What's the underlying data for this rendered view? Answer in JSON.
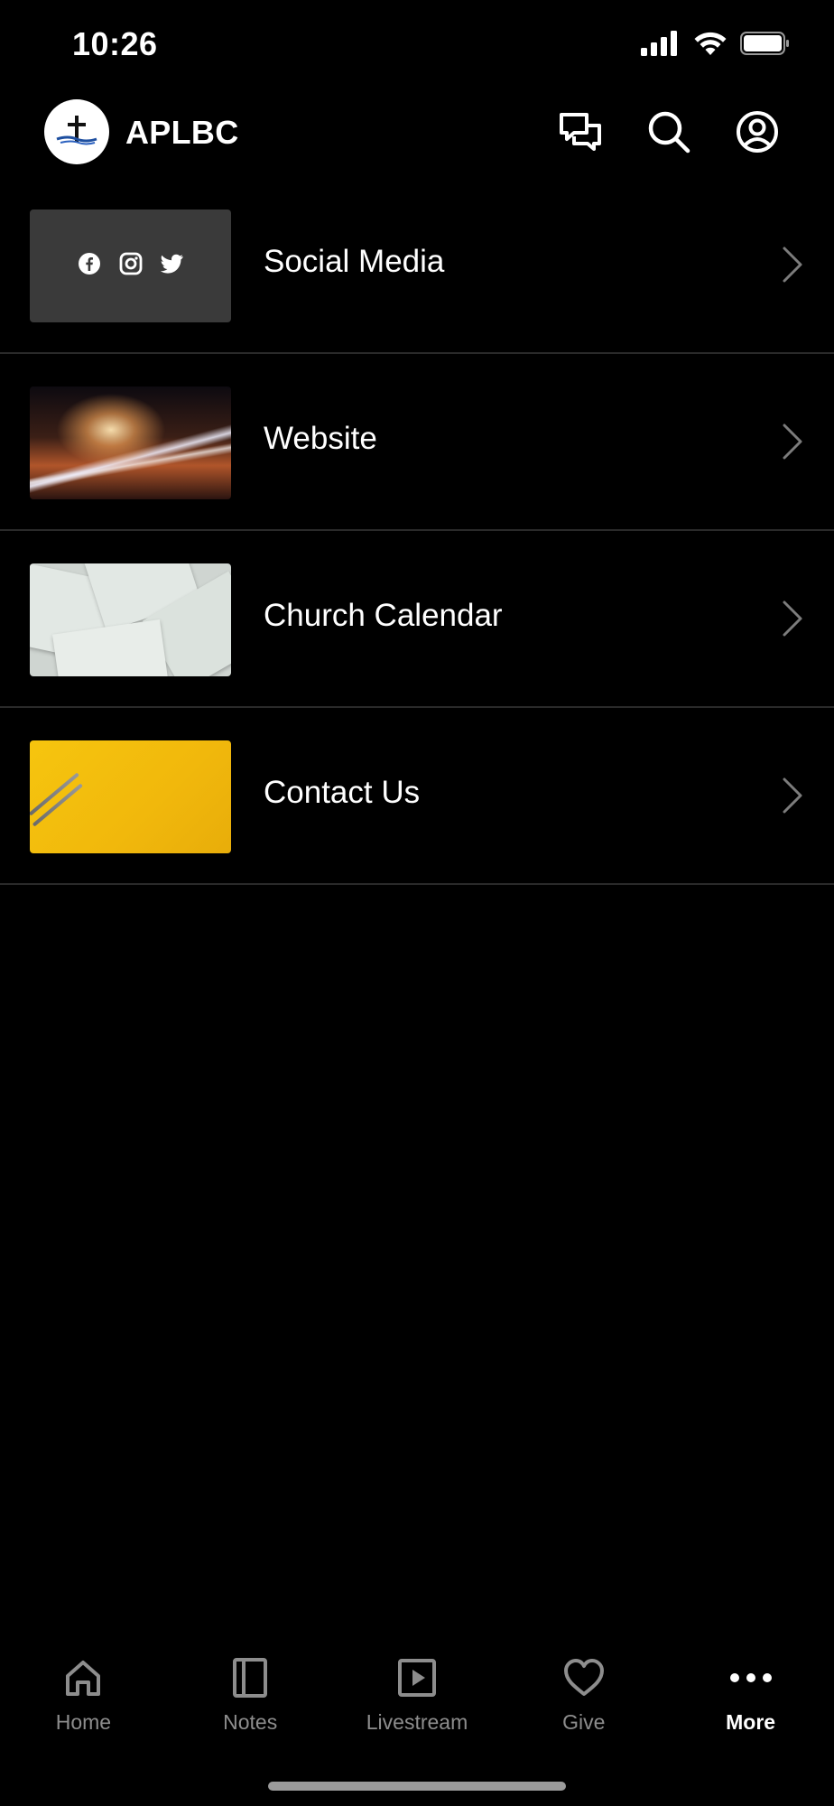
{
  "status_bar": {
    "time": "10:26"
  },
  "header": {
    "title": "APLBC",
    "logo_icon": "cross-logo-icon",
    "actions": [
      {
        "name": "messages-icon"
      },
      {
        "name": "search-icon"
      },
      {
        "name": "profile-icon"
      }
    ]
  },
  "list": {
    "items": [
      {
        "label": "Social Media",
        "thumbnail": "social-media-thumbnail"
      },
      {
        "label": "Website",
        "thumbnail": "website-thumbnail"
      },
      {
        "label": "Church Calendar",
        "thumbnail": "church-calendar-thumbnail"
      },
      {
        "label": "Contact Us",
        "thumbnail": "contact-us-thumbnail"
      }
    ]
  },
  "tab_bar": {
    "tabs": [
      {
        "label": "Home",
        "icon": "home-icon",
        "active": false
      },
      {
        "label": "Notes",
        "icon": "notes-icon",
        "active": false
      },
      {
        "label": "Livestream",
        "icon": "play-icon",
        "active": false
      },
      {
        "label": "Give",
        "icon": "heart-icon",
        "active": false
      },
      {
        "label": "More",
        "icon": "more-icon",
        "active": true
      }
    ]
  },
  "colors": {
    "background": "#000000",
    "divider": "#2a2a2a",
    "inactive_tab": "#8d8d8d",
    "active_tab": "#ffffff"
  }
}
